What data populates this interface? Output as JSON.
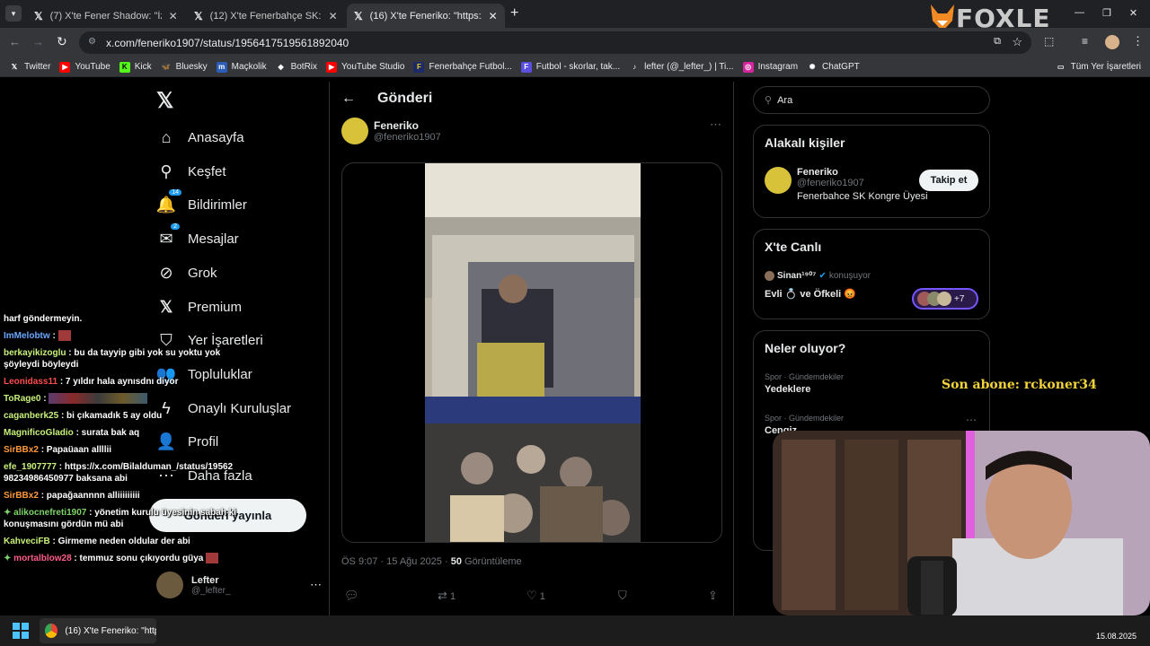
{
  "browser": {
    "tabs": [
      {
        "title": "(7) X'te Fener Shadow: \"İzmir'de",
        "active": false
      },
      {
        "title": "(12) X'te Fenerbahçe SK: \"Başka",
        "active": false
      },
      {
        "title": "(16) X'te Feneriko: \"https://",
        "active": true
      }
    ],
    "url": "x.com/feneriko1907/status/1956417519561892040",
    "bookmarks": [
      "Twitter",
      "YouTube",
      "Kick",
      "Bluesky",
      "Maçkolik",
      "BotRix",
      "YouTube Studio",
      "Fenerbahçe Futbol...",
      "Futbol - skorlar, tak...",
      "lefter (@_lefter_) | Ti...",
      "Instagram",
      "ChatGPT"
    ],
    "all_bookmarks": "Tüm Yer İşaretleri"
  },
  "stream": {
    "logo": "FOXLE",
    "subscriber": "Son abone: rckoner34"
  },
  "nav": {
    "items": [
      {
        "label": "Anasayfa",
        "icon": "home-icon"
      },
      {
        "label": "Keşfet",
        "icon": "search-icon"
      },
      {
        "label": "Bildirimler",
        "icon": "bell-icon",
        "badge": "14"
      },
      {
        "label": "Mesajlar",
        "icon": "mail-icon",
        "badge": "2"
      },
      {
        "label": "Grok",
        "icon": "grok-icon"
      },
      {
        "label": "Premium",
        "icon": "x-icon"
      },
      {
        "label": "Yer İşaretleri",
        "icon": "bookmark-icon"
      },
      {
        "label": "Topluluklar",
        "icon": "people-icon"
      },
      {
        "label": "Onaylı Kuruluşlar",
        "icon": "lightning-icon"
      },
      {
        "label": "Profil",
        "icon": "person-icon"
      },
      {
        "label": "Daha fazla",
        "icon": "more-icon"
      }
    ],
    "post_button": "Gönderi yayınla",
    "account_name": "Lefter",
    "account_handle": "@_lefter_"
  },
  "chat": [
    {
      "user": "",
      "color": "#7fd4ff",
      "text": "harf göndermeyin."
    },
    {
      "user": "ImMelobtw",
      "color": "#6aa8ff",
      "text": ":"
    },
    {
      "user": "berkayikizoglu",
      "color": "#c7f07a",
      "text": ": bu da tayyip gibi yok su yoktu yok şöyleydi böyleydi"
    },
    {
      "user": "Leonidass11",
      "color": "#ff4d4d",
      "text": ": 7 yıldır hala aynısdnı diyor"
    },
    {
      "user": "ToRage0",
      "color": "#c7f07a",
      "text": ":"
    },
    {
      "user": "caganberk25",
      "color": "#c7f07a",
      "text": ": bi çıkamadık 5 ay oldu"
    },
    {
      "user": "MagnificoGladio",
      "color": "#c7f07a",
      "text": ": surata bak aq"
    },
    {
      "user": "SirBBx2",
      "color": "#ff9a3c",
      "text": ": Papaüaan allllii"
    },
    {
      "user": "efe_1907777",
      "color": "#c7f07a",
      "text": ": https://x.com/Bilalduman_/status/1956298234986450977 baksana abi"
    },
    {
      "user": "SirBBx2",
      "color": "#ff9a3c",
      "text": ": papağaannnn alliiiiiiiii"
    },
    {
      "user": "alikocnefreti1907",
      "color": "#7fd46a",
      "text": ": yönetim kurulu üyesinin sabah ki konuşmasını gördün mü abi"
    },
    {
      "user": "KahveciFB",
      "color": "#c7f07a",
      "text": ": Girmeme neden oldular der abi"
    },
    {
      "user": "mortalblow28",
      "color": "#ff5c8a",
      "text": ": temmuz sonu çıkıyordu güya"
    }
  ],
  "post": {
    "header": "Gönderi",
    "author_name": "Feneriko",
    "author_handle": "@feneriko1907",
    "time": "ÖS 9:07 · 15 Ağu 2025 · ",
    "views": "50",
    "views_label": " Görüntüleme",
    "replies": "",
    "reposts": "1",
    "likes": "1"
  },
  "right": {
    "search_placeholder": "Ara",
    "related_title": "Alakalı kişiler",
    "related_name": "Feneriko",
    "related_handle": "@feneriko1907",
    "related_bio": "Fenerbahce SK Kongre Üyesi",
    "follow_button": "Takip et",
    "live_title": "X'te Canlı",
    "live_user": "Sinan¹⁹⁰⁷",
    "live_status": "konuşuyor",
    "live_text": "Evli 💍 ve Öfkeli 😡",
    "live_count": "+7",
    "trends_title": "Neler oluyor?",
    "trends": [
      {
        "cat": "Spor · Gündemdekiler",
        "title": "Yedeklere"
      },
      {
        "cat": "Spor · Gündemdekiler",
        "title": "Cengiz"
      }
    ]
  },
  "taskbar": {
    "app_title": "(16) X'te Feneriko: \"https:",
    "date": "15.08.2025"
  }
}
